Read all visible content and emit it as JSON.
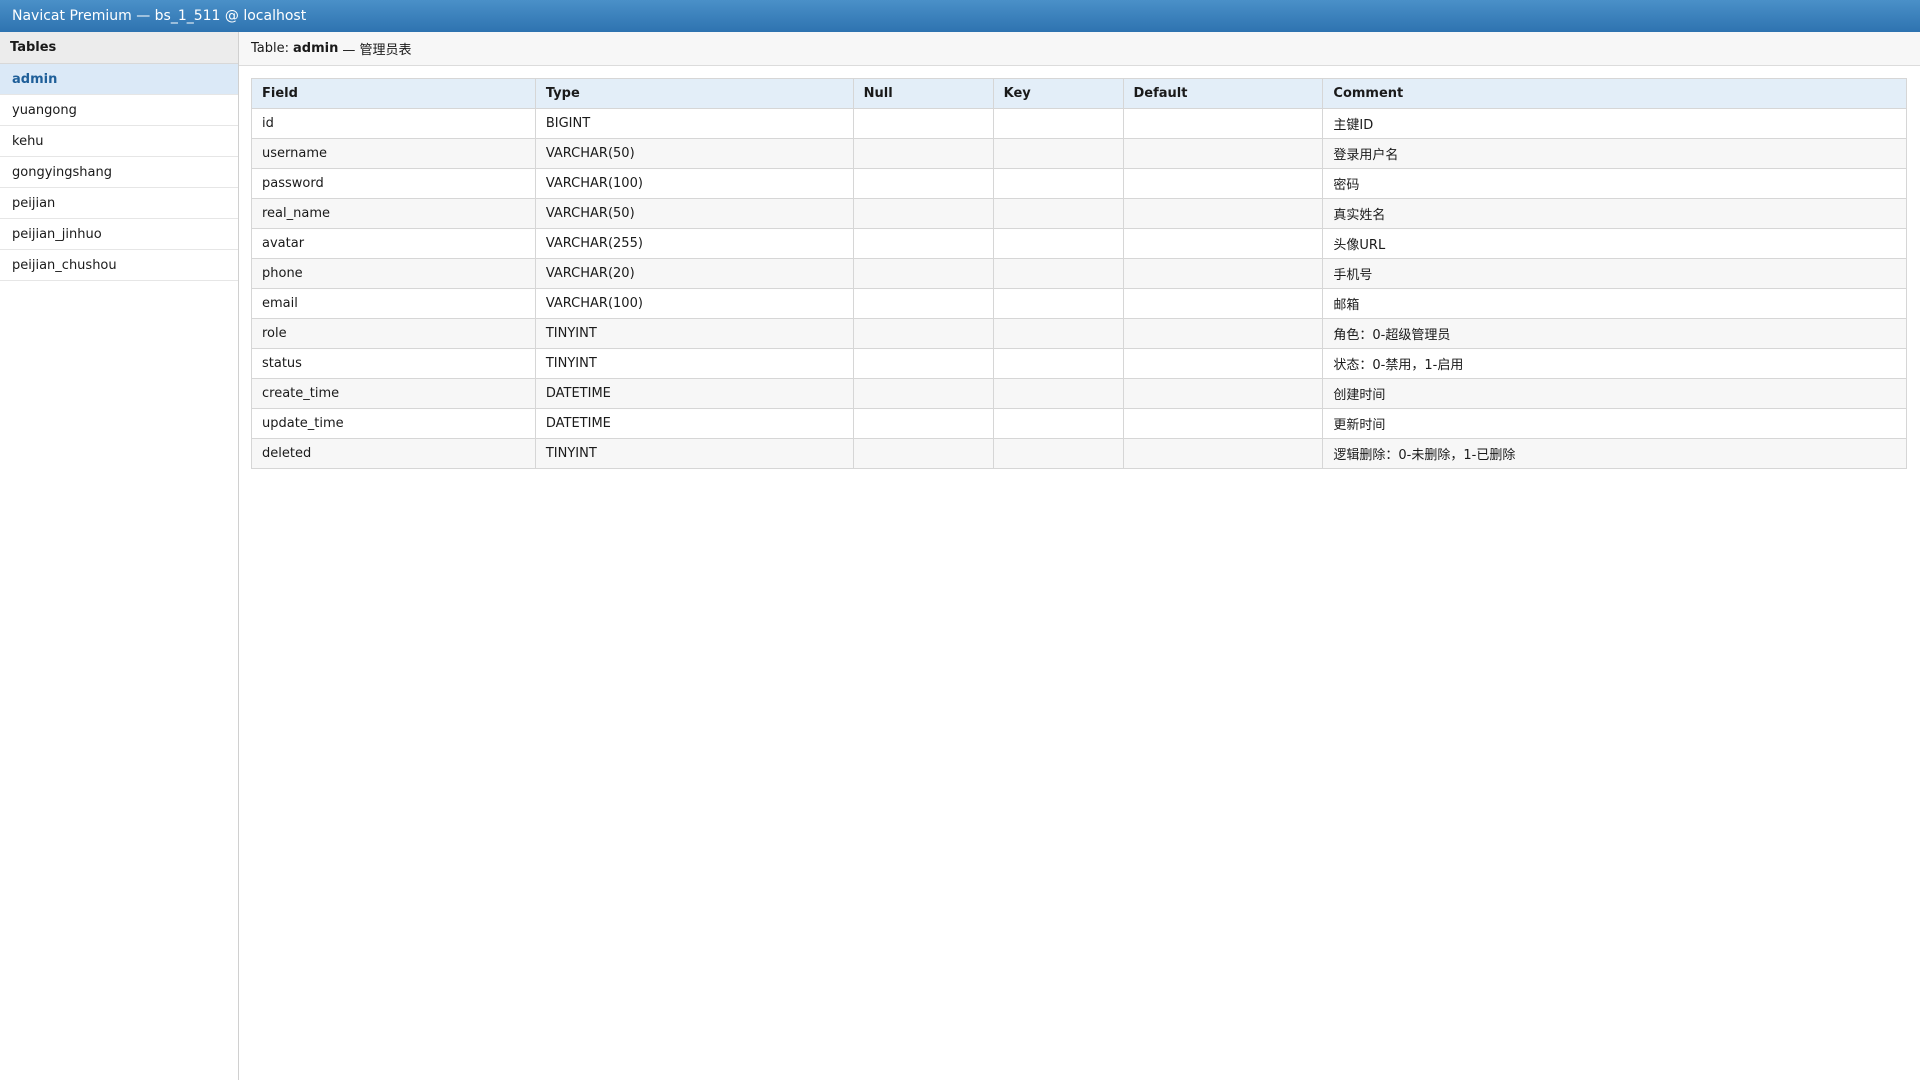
{
  "window": {
    "title": "Navicat Premium — bs_1_511 @ localhost"
  },
  "sidebar": {
    "header": "Tables",
    "items": [
      {
        "label": "admin",
        "active": true
      },
      {
        "label": "yuangong"
      },
      {
        "label": "kehu"
      },
      {
        "label": "gongyingshang"
      },
      {
        "label": "peijian"
      },
      {
        "label": "peijian_jinhuo"
      },
      {
        "label": "peijian_chushou"
      }
    ]
  },
  "main": {
    "header": {
      "prefix": "Table:",
      "table_name": "admin",
      "suffix": "— 管理员表"
    },
    "columns": [
      "Field",
      "Type",
      "Null",
      "Key",
      "Default",
      "Comment"
    ],
    "rows": [
      {
        "field": "id",
        "type": "BIGINT",
        "null": "",
        "key": "",
        "default": "",
        "comment": "主键ID"
      },
      {
        "field": "username",
        "type": "VARCHAR(50)",
        "null": "",
        "key": "",
        "default": "",
        "comment": "登录用户名"
      },
      {
        "field": "password",
        "type": "VARCHAR(100)",
        "null": "",
        "key": "",
        "default": "",
        "comment": "密码"
      },
      {
        "field": "real_name",
        "type": "VARCHAR(50)",
        "null": "",
        "key": "",
        "default": "",
        "comment": "真实姓名"
      },
      {
        "field": "avatar",
        "type": "VARCHAR(255)",
        "null": "",
        "key": "",
        "default": "",
        "comment": "头像URL"
      },
      {
        "field": "phone",
        "type": "VARCHAR(20)",
        "null": "",
        "key": "",
        "default": "",
        "comment": "手机号"
      },
      {
        "field": "email",
        "type": "VARCHAR(100)",
        "null": "",
        "key": "",
        "default": "",
        "comment": "邮箱"
      },
      {
        "field": "role",
        "type": "TINYINT",
        "null": "",
        "key": "",
        "default": "",
        "comment": "角色：0-超级管理员"
      },
      {
        "field": "status",
        "type": "TINYINT",
        "null": "",
        "key": "",
        "default": "",
        "comment": "状态：0-禁用，1-启用"
      },
      {
        "field": "create_time",
        "type": "DATETIME",
        "null": "",
        "key": "",
        "default": "",
        "comment": "创建时间"
      },
      {
        "field": "update_time",
        "type": "DATETIME",
        "null": "",
        "key": "",
        "default": "",
        "comment": "更新时间"
      },
      {
        "field": "deleted",
        "type": "TINYINT",
        "null": "",
        "key": "",
        "default": "",
        "comment": "逻辑删除：0-未删除，1-已删除"
      }
    ]
  },
  "colors": {
    "titlebar": "#2e73b0",
    "active_item_bg": "#dbe9f7",
    "active_item_text": "#1f5f99",
    "table_header_bg": "#e3eef8"
  }
}
